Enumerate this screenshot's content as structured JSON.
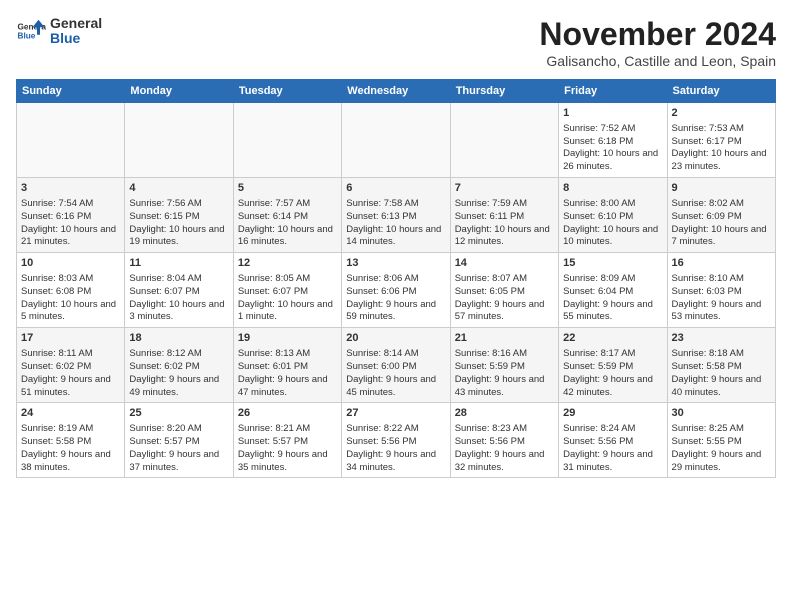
{
  "logo": {
    "general": "General",
    "blue": "Blue"
  },
  "header": {
    "month": "November 2024",
    "location": "Galisancho, Castille and Leon, Spain"
  },
  "weekdays": [
    "Sunday",
    "Monday",
    "Tuesday",
    "Wednesday",
    "Thursday",
    "Friday",
    "Saturday"
  ],
  "weeks": [
    [
      {
        "day": "",
        "info": ""
      },
      {
        "day": "",
        "info": ""
      },
      {
        "day": "",
        "info": ""
      },
      {
        "day": "",
        "info": ""
      },
      {
        "day": "",
        "info": ""
      },
      {
        "day": "1",
        "info": "Sunrise: 7:52 AM\nSunset: 6:18 PM\nDaylight: 10 hours and 26 minutes."
      },
      {
        "day": "2",
        "info": "Sunrise: 7:53 AM\nSunset: 6:17 PM\nDaylight: 10 hours and 23 minutes."
      }
    ],
    [
      {
        "day": "3",
        "info": "Sunrise: 7:54 AM\nSunset: 6:16 PM\nDaylight: 10 hours and 21 minutes."
      },
      {
        "day": "4",
        "info": "Sunrise: 7:56 AM\nSunset: 6:15 PM\nDaylight: 10 hours and 19 minutes."
      },
      {
        "day": "5",
        "info": "Sunrise: 7:57 AM\nSunset: 6:14 PM\nDaylight: 10 hours and 16 minutes."
      },
      {
        "day": "6",
        "info": "Sunrise: 7:58 AM\nSunset: 6:13 PM\nDaylight: 10 hours and 14 minutes."
      },
      {
        "day": "7",
        "info": "Sunrise: 7:59 AM\nSunset: 6:11 PM\nDaylight: 10 hours and 12 minutes."
      },
      {
        "day": "8",
        "info": "Sunrise: 8:00 AM\nSunset: 6:10 PM\nDaylight: 10 hours and 10 minutes."
      },
      {
        "day": "9",
        "info": "Sunrise: 8:02 AM\nSunset: 6:09 PM\nDaylight: 10 hours and 7 minutes."
      }
    ],
    [
      {
        "day": "10",
        "info": "Sunrise: 8:03 AM\nSunset: 6:08 PM\nDaylight: 10 hours and 5 minutes."
      },
      {
        "day": "11",
        "info": "Sunrise: 8:04 AM\nSunset: 6:07 PM\nDaylight: 10 hours and 3 minutes."
      },
      {
        "day": "12",
        "info": "Sunrise: 8:05 AM\nSunset: 6:07 PM\nDaylight: 10 hours and 1 minute."
      },
      {
        "day": "13",
        "info": "Sunrise: 8:06 AM\nSunset: 6:06 PM\nDaylight: 9 hours and 59 minutes."
      },
      {
        "day": "14",
        "info": "Sunrise: 8:07 AM\nSunset: 6:05 PM\nDaylight: 9 hours and 57 minutes."
      },
      {
        "day": "15",
        "info": "Sunrise: 8:09 AM\nSunset: 6:04 PM\nDaylight: 9 hours and 55 minutes."
      },
      {
        "day": "16",
        "info": "Sunrise: 8:10 AM\nSunset: 6:03 PM\nDaylight: 9 hours and 53 minutes."
      }
    ],
    [
      {
        "day": "17",
        "info": "Sunrise: 8:11 AM\nSunset: 6:02 PM\nDaylight: 9 hours and 51 minutes."
      },
      {
        "day": "18",
        "info": "Sunrise: 8:12 AM\nSunset: 6:02 PM\nDaylight: 9 hours and 49 minutes."
      },
      {
        "day": "19",
        "info": "Sunrise: 8:13 AM\nSunset: 6:01 PM\nDaylight: 9 hours and 47 minutes."
      },
      {
        "day": "20",
        "info": "Sunrise: 8:14 AM\nSunset: 6:00 PM\nDaylight: 9 hours and 45 minutes."
      },
      {
        "day": "21",
        "info": "Sunrise: 8:16 AM\nSunset: 5:59 PM\nDaylight: 9 hours and 43 minutes."
      },
      {
        "day": "22",
        "info": "Sunrise: 8:17 AM\nSunset: 5:59 PM\nDaylight: 9 hours and 42 minutes."
      },
      {
        "day": "23",
        "info": "Sunrise: 8:18 AM\nSunset: 5:58 PM\nDaylight: 9 hours and 40 minutes."
      }
    ],
    [
      {
        "day": "24",
        "info": "Sunrise: 8:19 AM\nSunset: 5:58 PM\nDaylight: 9 hours and 38 minutes."
      },
      {
        "day": "25",
        "info": "Sunrise: 8:20 AM\nSunset: 5:57 PM\nDaylight: 9 hours and 37 minutes."
      },
      {
        "day": "26",
        "info": "Sunrise: 8:21 AM\nSunset: 5:57 PM\nDaylight: 9 hours and 35 minutes."
      },
      {
        "day": "27",
        "info": "Sunrise: 8:22 AM\nSunset: 5:56 PM\nDaylight: 9 hours and 34 minutes."
      },
      {
        "day": "28",
        "info": "Sunrise: 8:23 AM\nSunset: 5:56 PM\nDaylight: 9 hours and 32 minutes."
      },
      {
        "day": "29",
        "info": "Sunrise: 8:24 AM\nSunset: 5:56 PM\nDaylight: 9 hours and 31 minutes."
      },
      {
        "day": "30",
        "info": "Sunrise: 8:25 AM\nSunset: 5:55 PM\nDaylight: 9 hours and 29 minutes."
      }
    ]
  ]
}
